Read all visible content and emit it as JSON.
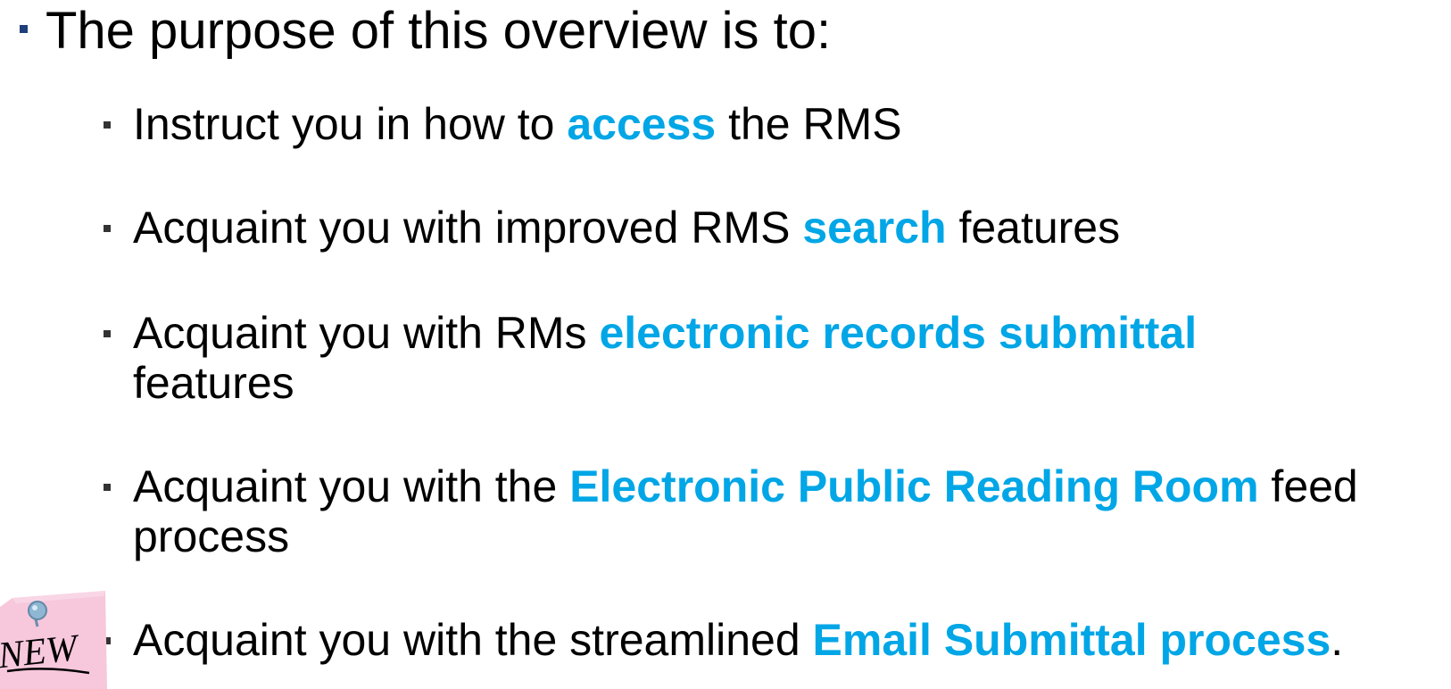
{
  "main_bullet": "The purpose of this overview is to:",
  "items": [
    {
      "before": "Instruct you in how to ",
      "highlight": "access",
      "after": " the RMS",
      "continuation": ""
    },
    {
      "before": "Acquaint you with improved RMS ",
      "highlight": "search",
      "after": " features",
      "continuation": ""
    },
    {
      "before": "Acquaint you with RMs ",
      "highlight": "electronic records submittal",
      "after": "",
      "continuation": "features"
    },
    {
      "before": "Acquaint you with the ",
      "highlight": "Electronic Public Reading Room",
      "after": " feed",
      "continuation": "process"
    },
    {
      "before": "Acquaint you with the streamlined ",
      "highlight": "Email Submittal process",
      "after": ".",
      "continuation": ""
    }
  ],
  "new_note": {
    "label": "NEW",
    "icon": "pinned-sticky-note-icon"
  },
  "colors": {
    "highlight": "#00a6e6",
    "main_marker": "#1f3f7a",
    "text": "#000000",
    "note": "#f7c7dc"
  }
}
